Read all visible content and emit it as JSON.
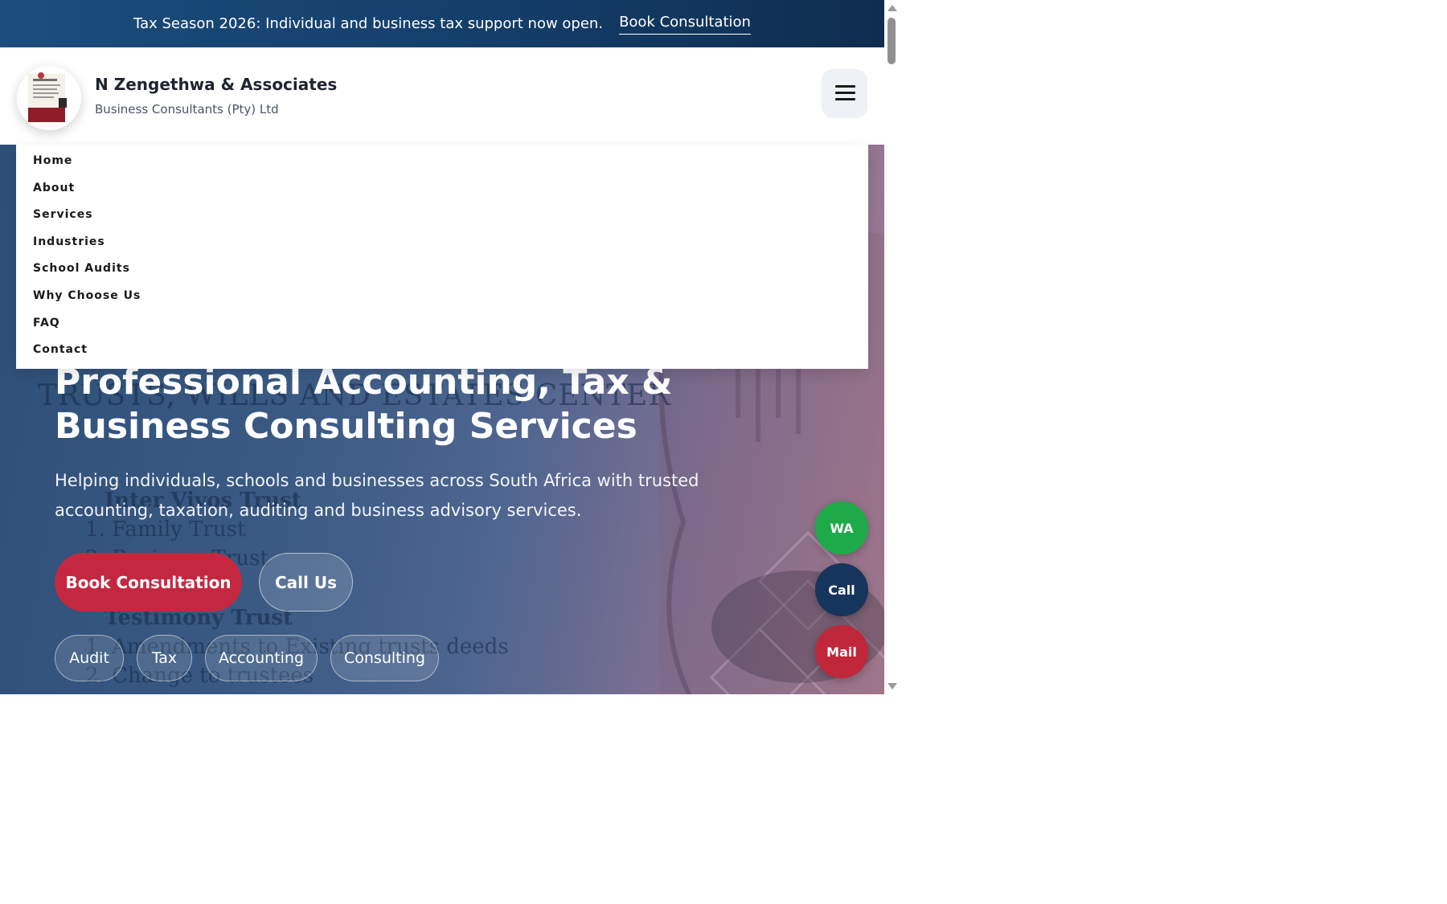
{
  "announcement": {
    "text": "Tax Season 2026: Individual and business tax support now open.",
    "link_label": "Book Consultation"
  },
  "header": {
    "brand_name": "N Zengethwa & Associates",
    "brand_sub": "Business Consultants (Pty) Ltd",
    "menu_icon": "hamburger-icon"
  },
  "nav": {
    "items": [
      "Home",
      "About",
      "Services",
      "Industries",
      "School Audits",
      "Why Choose Us",
      "FAQ",
      "Contact"
    ]
  },
  "hero": {
    "title": "Professional Accounting, Tax & Business Consulting Services",
    "description": "Helping individuals, schools and businesses across South Africa with trusted accounting, taxation, auditing and business advisory services.",
    "primary_button": "Book Consultation",
    "secondary_button": "Call Us",
    "tags": [
      "Audit",
      "Tax",
      "Accounting",
      "Consulting"
    ],
    "background_text": {
      "title": "TRUSTS, WILLS AND ESTATES CENTER",
      "lines": [
        "Inter Vivos Trust",
        "1. Family Trust",
        "2. Business Trust",
        "Testimony Trust",
        "1. Amendments to Existing trusts deeds",
        "2. Change to trustees"
      ]
    }
  },
  "floating_actions": {
    "whatsapp": "WA",
    "call": "Call",
    "mail": "Mail"
  },
  "colors": {
    "brand_navy": "#143e6a",
    "accent_red": "#c42840",
    "whatsapp_green": "#1faa4a",
    "call_navy": "#15355c",
    "mail_red": "#c0273a"
  }
}
